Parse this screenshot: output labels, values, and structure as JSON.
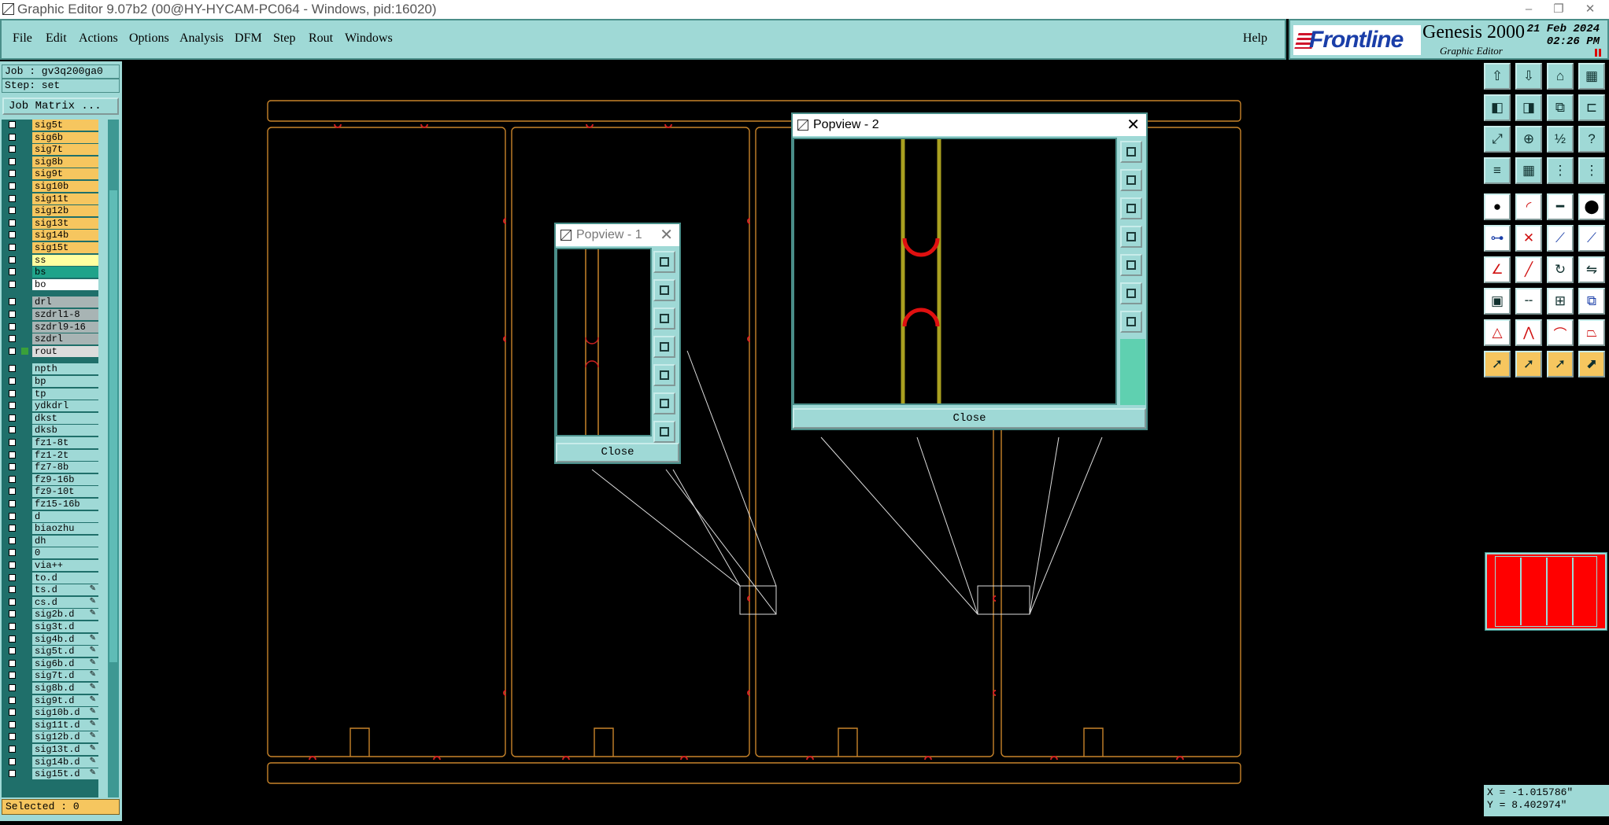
{
  "window": {
    "title": "Graphic Editor 9.07b2 (00@HY-HYCAM-PC064 - Windows, pid:16020)"
  },
  "menu": {
    "items": [
      "File",
      "Edit",
      "Actions",
      "Options",
      "Analysis",
      "DFM",
      "Step",
      "Rout",
      "Windows"
    ],
    "help": "Help"
  },
  "brand": {
    "logo": "Frontline",
    "product": "Genesis 2000",
    "subtitle": "Graphic Editor",
    "date": "21 Feb 2024",
    "time": "02:26 PM"
  },
  "job": {
    "label": "Job : gv3q200ga0",
    "step": "Step: set",
    "matrix_button": "Job Matrix ..."
  },
  "layers": [
    {
      "name": "sig5t",
      "color": "#f6c65f"
    },
    {
      "name": "sig6b",
      "color": "#f6c65f"
    },
    {
      "name": "sig7t",
      "color": "#f6c65f"
    },
    {
      "name": "sig8b",
      "color": "#f6c65f"
    },
    {
      "name": "sig9t",
      "color": "#f6c65f"
    },
    {
      "name": "sig10b",
      "color": "#f6c65f"
    },
    {
      "name": "sig11t",
      "color": "#f6c65f"
    },
    {
      "name": "sig12b",
      "color": "#f6c65f"
    },
    {
      "name": "sig13t",
      "color": "#f6c65f"
    },
    {
      "name": "sig14b",
      "color": "#f6c65f"
    },
    {
      "name": "sig15t",
      "color": "#f6c65f"
    },
    {
      "name": "ss",
      "color": "#ffffa0"
    },
    {
      "name": "bs",
      "color": "#1fa38a"
    },
    {
      "name": "bo",
      "color": "#ffffff"
    },
    {
      "name": "drl",
      "color": "#a8b4b4",
      "gap": true
    },
    {
      "name": "szdrl1-8",
      "color": "#a8b4b4"
    },
    {
      "name": "szdrl9-16",
      "color": "#a8b4b4"
    },
    {
      "name": "szdrl",
      "color": "#a8b4b4"
    },
    {
      "name": "rout",
      "color": "#dcdcdc",
      "active": true
    },
    {
      "name": "npth",
      "color": "#9fd9d6",
      "gap": true
    },
    {
      "name": "bp",
      "color": "#9fd9d6"
    },
    {
      "name": "tp",
      "color": "#9fd9d6"
    },
    {
      "name": "ydkdrl",
      "color": "#9fd9d6"
    },
    {
      "name": "dkst",
      "color": "#9fd9d6"
    },
    {
      "name": "dksb",
      "color": "#9fd9d6"
    },
    {
      "name": "fz1-8t",
      "color": "#9fd9d6"
    },
    {
      "name": "fz1-2t",
      "color": "#9fd9d6"
    },
    {
      "name": "fz7-8b",
      "color": "#9fd9d6"
    },
    {
      "name": "fz9-16b",
      "color": "#9fd9d6"
    },
    {
      "name": "fz9-10t",
      "color": "#9fd9d6"
    },
    {
      "name": "fz15-16b",
      "color": "#9fd9d6"
    },
    {
      "name": "d",
      "color": "#9fd9d6"
    },
    {
      "name": "biaozhu",
      "color": "#9fd9d6"
    },
    {
      "name": "dh",
      "color": "#9fd9d6"
    },
    {
      "name": "0",
      "color": "#9fd9d6"
    },
    {
      "name": "via++",
      "color": "#9fd9d6"
    },
    {
      "name": "to.d",
      "color": "#9fd9d6"
    },
    {
      "name": "ts.d",
      "color": "#9fd9d6",
      "pen": true
    },
    {
      "name": "cs.d",
      "color": "#9fd9d6",
      "pen": true
    },
    {
      "name": "sig2b.d",
      "color": "#9fd9d6",
      "pen": true
    },
    {
      "name": "sig3t.d",
      "color": "#9fd9d6"
    },
    {
      "name": "sig4b.d",
      "color": "#9fd9d6",
      "pen": true
    },
    {
      "name": "sig5t.d",
      "color": "#9fd9d6",
      "pen": true
    },
    {
      "name": "sig6b.d",
      "color": "#9fd9d6",
      "pen": true
    },
    {
      "name": "sig7t.d",
      "color": "#9fd9d6",
      "pen": true
    },
    {
      "name": "sig8b.d",
      "color": "#9fd9d6",
      "pen": true
    },
    {
      "name": "sig9t.d",
      "color": "#9fd9d6",
      "pen": true
    },
    {
      "name": "sig10b.d",
      "color": "#9fd9d6",
      "pen": true
    },
    {
      "name": "sig11t.d",
      "color": "#9fd9d6",
      "pen": true
    },
    {
      "name": "sig12b.d",
      "color": "#9fd9d6",
      "pen": true
    },
    {
      "name": "sig13t.d",
      "color": "#9fd9d6",
      "pen": true
    },
    {
      "name": "sig14b.d",
      "color": "#9fd9d6",
      "pen": true
    },
    {
      "name": "sig15t.d",
      "color": "#9fd9d6",
      "pen": true
    }
  ],
  "status": {
    "selected": "Selected : 0",
    "x": "X = -1.015786\"",
    "y": "Y = 8.402974\""
  },
  "popview1": {
    "title": "Popview - 1",
    "close": "Close"
  },
  "popview2": {
    "title": "Popview - 2",
    "close": "Close"
  },
  "toolbar": [
    {
      "icon": "layer-up-icon",
      "color": "#9fd9d6"
    },
    {
      "icon": "layer-down-icon",
      "color": "#9fd9d6"
    },
    {
      "icon": "home-icon",
      "color": "#9fd9d6"
    },
    {
      "icon": "panel-icon",
      "color": "#9fd9d6"
    },
    {
      "icon": "zoom-left-icon",
      "color": "#9fd9d6"
    },
    {
      "icon": "zoom-right-icon",
      "color": "#9fd9d6"
    },
    {
      "icon": "zoom-window-icon",
      "color": "#9fd9d6"
    },
    {
      "icon": "snap-icon",
      "color": "#9fd9d6"
    },
    {
      "icon": "fit-icon",
      "color": "#9fd9d6"
    },
    {
      "icon": "zoom-home-icon",
      "color": "#9fd9d6"
    },
    {
      "icon": "ratio-icon",
      "color": "#9fd9d6"
    },
    {
      "icon": "help-icon",
      "color": "#9fd9d6"
    },
    {
      "icon": "measure-icon",
      "color": "#9fd9d6"
    },
    {
      "icon": "grid-icon",
      "color": "#9fd9d6"
    },
    {
      "icon": "net-icon",
      "color": "#9fd9d6"
    },
    {
      "icon": "route-icon",
      "color": "#9fd9d6"
    },
    {
      "icon": "pad-icon",
      "color": "#ffffff"
    },
    {
      "icon": "arc-icon",
      "color": "#ffffff"
    },
    {
      "icon": "line-icon",
      "color": "#ffffff"
    },
    {
      "icon": "circle-icon",
      "color": "#ffffff"
    },
    {
      "icon": "connect-icon",
      "color": "#ffffff"
    },
    {
      "icon": "cross-icon",
      "color": "#ffffff"
    },
    {
      "icon": "point-line-icon",
      "color": "#ffffff"
    },
    {
      "icon": "diagonal-icon",
      "color": "#ffffff"
    },
    {
      "icon": "angle-icon",
      "color": "#ffffff"
    },
    {
      "icon": "slash-icon",
      "color": "#ffffff"
    },
    {
      "icon": "rotate-icon",
      "color": "#ffffff"
    },
    {
      "icon": "mirror-icon",
      "color": "#ffffff"
    },
    {
      "icon": "box-point-icon",
      "color": "#ffffff"
    },
    {
      "icon": "dash-icon",
      "color": "#ffffff"
    },
    {
      "icon": "split-icon",
      "color": "#ffffff"
    },
    {
      "icon": "copy-icon",
      "color": "#ffffff"
    },
    {
      "icon": "triangle-icon",
      "color": "#ffffff"
    },
    {
      "icon": "peak-icon",
      "color": "#ffffff"
    },
    {
      "icon": "arch-icon",
      "color": "#ffffff"
    },
    {
      "icon": "trapezoid-icon",
      "color": "#ffffff"
    },
    {
      "icon": "pointer-icon",
      "color": "#f6c65f"
    },
    {
      "icon": "select-icon",
      "color": "#f6c65f"
    },
    {
      "icon": "select-add-icon",
      "color": "#f6c65f"
    },
    {
      "icon": "select-multi-icon",
      "color": "#f6c65f"
    }
  ]
}
